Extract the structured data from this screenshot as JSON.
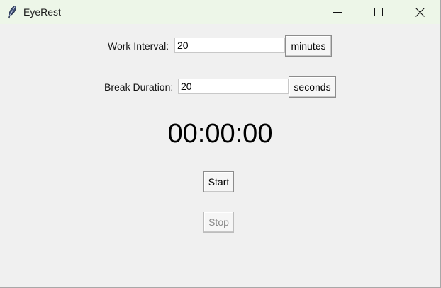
{
  "window": {
    "title": "EyeRest",
    "controls": {
      "minimize": "minimize-icon",
      "maximize": "maximize-icon",
      "close": "close-icon"
    }
  },
  "work": {
    "label": "Work Interval:",
    "value": "20",
    "unit_button": "minutes"
  },
  "break": {
    "label": "Break Duration:",
    "value": "20",
    "unit_button": "seconds"
  },
  "timer": {
    "display": "00:00:00"
  },
  "actions": {
    "start_label": "Start",
    "stop_label": "Stop"
  },
  "colors": {
    "titlebar_bg": "#edf6e8",
    "window_bg": "#f0f0f0",
    "disabled_text": "#8a8a8a"
  }
}
